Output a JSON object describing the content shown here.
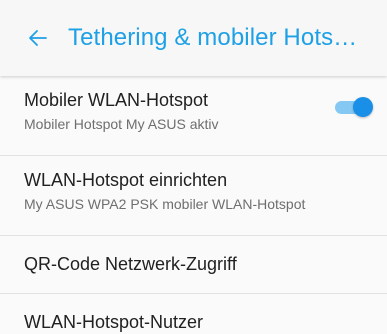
{
  "header": {
    "title": "Tethering & mobiler Hots…",
    "accent_color": "#1ea0e6",
    "back_icon": "arrow-left-icon"
  },
  "settings": [
    {
      "title": "Mobiler WLAN-Hotspot",
      "subtitle": "Mobiler Hotspot My ASUS aktiv",
      "toggle_on": true
    },
    {
      "title": "WLAN-Hotspot einrichten",
      "subtitle": "My ASUS WPA2 PSK mobiler WLAN-Hotspot"
    },
    {
      "title": "QR-Code Netzwerk-Zugriff"
    },
    {
      "title": "WLAN-Hotspot-Nutzer"
    }
  ],
  "colors": {
    "toggle_thumb": "#1a8fe8",
    "toggle_track": "#85c8f3",
    "text_primary": "#212121",
    "text_secondary": "#6e6e6e"
  }
}
